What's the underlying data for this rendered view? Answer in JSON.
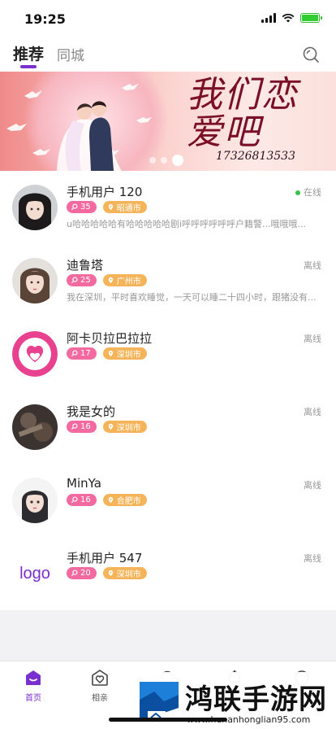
{
  "status_bar": {
    "time": "19:25"
  },
  "tabs": [
    {
      "label": "推荐",
      "active": true
    },
    {
      "label": "同城",
      "active": false
    }
  ],
  "banner": {
    "title": "我们恋爱吧",
    "phone": "17326813533",
    "slide_count": 3,
    "active_slide": 3
  },
  "users": [
    {
      "name": "手机用户 120",
      "age": "35",
      "city": "昭通市",
      "status": "在线",
      "online": true,
      "bio": "u哈哈哈哈哈有哈哈哈哈哈剧i呼呼呼呼呼呼户籍警...哦哦哦...",
      "avatar": "avatar-photo-girl-dark"
    },
    {
      "name": "迪鲁塔",
      "age": "25",
      "city": "广州市",
      "status": "离线",
      "online": false,
      "bio": "我在深圳，平时喜欢睡觉，一天可以睡二十四小时，跟猪没有...",
      "avatar": "avatar-photo-girl"
    },
    {
      "name": "阿卡贝拉巴拉拉",
      "age": "17",
      "city": "深圳市",
      "status": "离线",
      "online": false,
      "bio": "",
      "avatar": "avatar-pink-flower-logo"
    },
    {
      "name": "我是女的",
      "age": "16",
      "city": "深圳市",
      "status": "离线",
      "online": false,
      "bio": "",
      "avatar": "avatar-photo-dark"
    },
    {
      "name": "MinYa",
      "age": "16",
      "city": "合肥市",
      "status": "离线",
      "online": false,
      "bio": "",
      "avatar": "avatar-illustrated-girl"
    },
    {
      "name": "手机用户 547",
      "age": "20",
      "city": "深圳市",
      "status": "离线",
      "online": false,
      "bio": "",
      "avatar": "avatar-logo-text",
      "avatar_text": "logo"
    }
  ],
  "bottom_nav": [
    {
      "label": "首页",
      "icon": "home-icon",
      "active": true
    },
    {
      "label": "相亲",
      "icon": "heart-box-icon",
      "active": false
    },
    {
      "label": "",
      "icon": "refresh-icon",
      "active": false
    },
    {
      "label": "",
      "icon": "bell-icon",
      "active": false
    },
    {
      "label": "",
      "icon": "face-icon",
      "active": false
    }
  ],
  "watermark": {
    "title": "鸿联手游网",
    "url": "www.henanhonglian95.com"
  },
  "colors": {
    "accent": "#7a2fd0",
    "age_badge": "#f26aa0",
    "city_badge": "#f5b45a",
    "online_dot": "#3bc24a"
  }
}
